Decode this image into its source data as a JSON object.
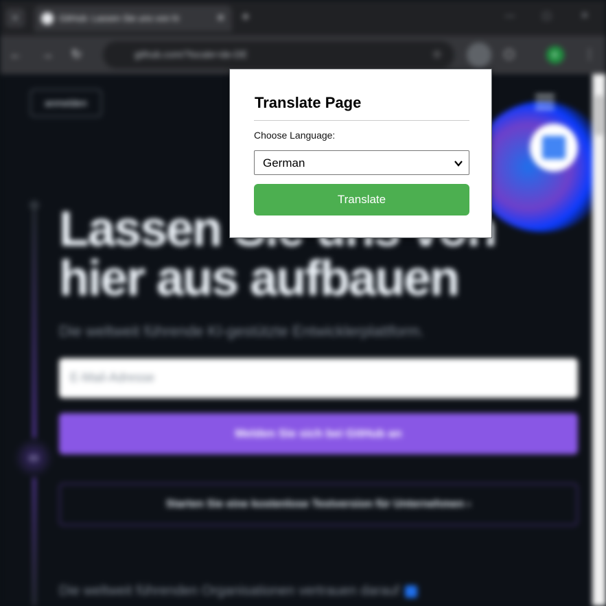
{
  "popup": {
    "title": "Translate Page",
    "language_label": "Choose Language:",
    "selected_language": "German",
    "translate_button": "Translate",
    "accent_color": "#4caf50"
  },
  "browser": {
    "tab_title": "GitHub: Lassen Sie uns von hi",
    "address": "github.com/?locale=de-DE",
    "profile_initial": "K"
  },
  "page": {
    "signin_label": "anmelden",
    "hero_title_line1": "Lassen Sie uns von",
    "hero_title_line2": "hier aus aufbauen",
    "hero_subtitle": "Die weltweit führende KI-gestützte Entwicklerplattform.",
    "email_placeholder": "E-Mail-Adresse",
    "signup_button": "Melden Sie sich bei GitHub an",
    "trial_button": "Starten Sie eine kostenlose Testversion für Unternehmen ›",
    "trust_text": "Die weltweit führenden Organisationen vertrauen darauf",
    "primary_color": "#8957e5"
  }
}
